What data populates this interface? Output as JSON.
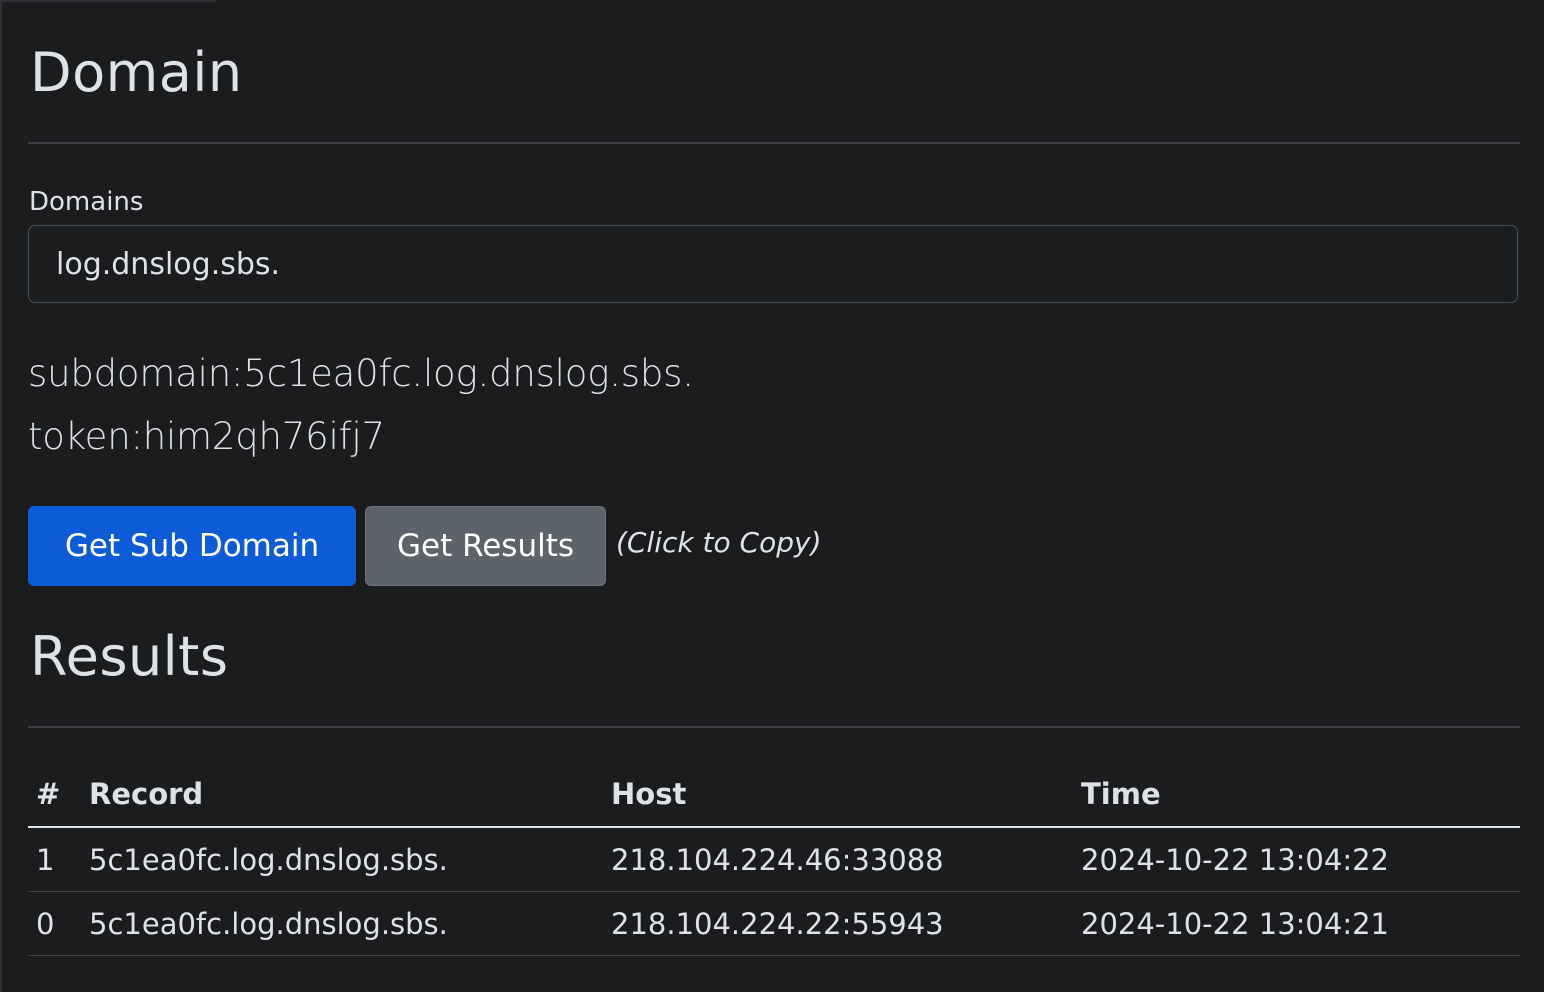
{
  "domain_section": {
    "title": "Domain",
    "label": "Domains",
    "input_value": "log.dnslog.sbs."
  },
  "info": {
    "subdomain_line": "subdomain:5c1ea0fc.log.dnslog.sbs.",
    "token_line": "token:him2qh76ifj7"
  },
  "actions": {
    "get_sub_domain": "Get Sub Domain",
    "get_results": "Get Results",
    "copy_hint": "(Click to Copy)"
  },
  "results_section": {
    "title": "Results",
    "columns": [
      "#",
      "Record",
      "Host",
      "Time"
    ],
    "rows": [
      {
        "num": "1",
        "record": "5c1ea0fc.log.dnslog.sbs.",
        "host": "218.104.224.46:33088",
        "time": "2024-10-22 13:04:22"
      },
      {
        "num": "0",
        "record": "5c1ea0fc.log.dnslog.sbs.",
        "host": "218.104.224.22:55943",
        "time": "2024-10-22 13:04:21"
      }
    ]
  },
  "colors": {
    "background": "#1b1c1e",
    "primary": "#0d5bd6",
    "secondary": "#5c636a",
    "text": "#dee2e6"
  }
}
